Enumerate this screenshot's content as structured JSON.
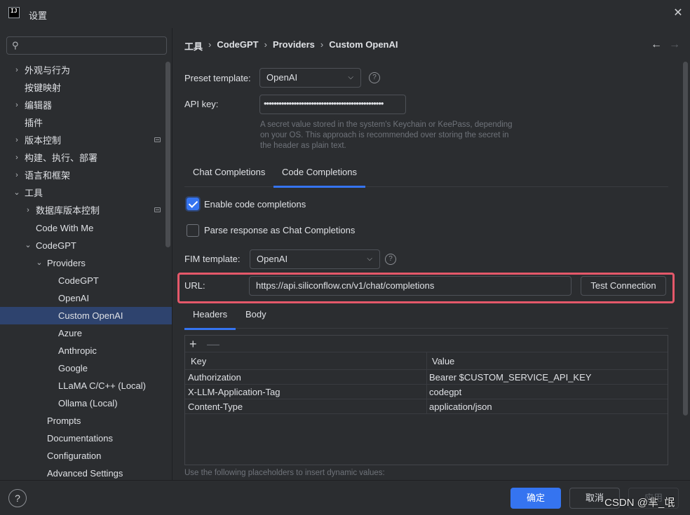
{
  "window": {
    "title": "设置",
    "logo_text": "IJ"
  },
  "search": {
    "placeholder": "",
    "icon": "search-icon"
  },
  "sidebar": {
    "items": [
      {
        "label": "外观与行为",
        "indent": 0,
        "chevron": "›",
        "badge": false
      },
      {
        "label": "按键映射",
        "indent": 0,
        "chevron": "",
        "badge": false
      },
      {
        "label": "编辑器",
        "indent": 0,
        "chevron": "›",
        "badge": false
      },
      {
        "label": "插件",
        "indent": 0,
        "chevron": "",
        "badge": false
      },
      {
        "label": "版本控制",
        "indent": 0,
        "chevron": "›",
        "badge": true
      },
      {
        "label": "构建、执行、部署",
        "indent": 0,
        "chevron": "›",
        "badge": false
      },
      {
        "label": "语言和框架",
        "indent": 0,
        "chevron": "›",
        "badge": false
      },
      {
        "label": "工具",
        "indent": 0,
        "chevron": "⌄",
        "badge": false
      },
      {
        "label": "数据库版本控制",
        "indent": 1,
        "chevron": "›",
        "badge": true
      },
      {
        "label": "Code With Me",
        "indent": 1,
        "chevron": "",
        "badge": false
      },
      {
        "label": "CodeGPT",
        "indent": 1,
        "chevron": "⌄",
        "badge": false
      },
      {
        "label": "Providers",
        "indent": 2,
        "chevron": "⌄",
        "badge": false
      },
      {
        "label": "CodeGPT",
        "indent": 3,
        "chevron": "",
        "badge": false
      },
      {
        "label": "OpenAI",
        "indent": 3,
        "chevron": "",
        "badge": false
      },
      {
        "label": "Custom OpenAI",
        "indent": 3,
        "chevron": "",
        "badge": false,
        "selected": true
      },
      {
        "label": "Azure",
        "indent": 3,
        "chevron": "",
        "badge": false
      },
      {
        "label": "Anthropic",
        "indent": 3,
        "chevron": "",
        "badge": false
      },
      {
        "label": "Google",
        "indent": 3,
        "chevron": "",
        "badge": false
      },
      {
        "label": "LLaMA C/C++ (Local)",
        "indent": 3,
        "chevron": "",
        "badge": false
      },
      {
        "label": "Ollama (Local)",
        "indent": 3,
        "chevron": "",
        "badge": false
      },
      {
        "label": "Prompts",
        "indent": 2,
        "chevron": "",
        "badge": false
      },
      {
        "label": "Documentations",
        "indent": 2,
        "chevron": "",
        "badge": false
      },
      {
        "label": "Configuration",
        "indent": 2,
        "chevron": "",
        "badge": false
      },
      {
        "label": "Advanced Settings",
        "indent": 2,
        "chevron": "",
        "badge": false
      }
    ]
  },
  "breadcrumb": [
    "工具",
    "CodeGPT",
    "Providers",
    "Custom OpenAI"
  ],
  "nav": {
    "back": "←",
    "forward": "→"
  },
  "form": {
    "preset_label": "Preset template:",
    "preset_value": "OpenAI",
    "api_key_label": "API key:",
    "api_key_value": "••••••••••••••••••••••••••••••••••••••••••••••••",
    "api_key_hint": "A secret value stored in the system's Keychain or KeePass, depending on your OS. This approach is recommended over storing the secret in the header as plain text.",
    "help_glyph": "?"
  },
  "tabs_main": {
    "items": [
      "Chat Completions",
      "Code Completions"
    ],
    "active": "Code Completions"
  },
  "code": {
    "enable_label": "Enable code completions",
    "enable_checked": true,
    "parse_label": "Parse response as Chat Completions",
    "parse_checked": false,
    "fim_label": "FIM template:",
    "fim_value": "OpenAI",
    "url_label": "URL:",
    "url_value": "https://api.siliconflow.cn/v1/chat/completions",
    "test_button": "Test Connection"
  },
  "tabs_sub": {
    "items": [
      "Headers",
      "Body"
    ],
    "active": "Headers"
  },
  "headers_table": {
    "add_glyph": "+",
    "remove_glyph": "—",
    "columns": [
      "Key",
      "Value"
    ],
    "rows": [
      [
        "Authorization",
        "Bearer $CUSTOM_SERVICE_API_KEY"
      ],
      [
        "X-LLM-Application-Tag",
        "codegpt"
      ],
      [
        "Content-Type",
        "application/json"
      ]
    ]
  },
  "placeholder_hint": "Use the following placeholders to insert dynamic values:",
  "footer": {
    "help": "?",
    "ok": "确定",
    "cancel": "取消",
    "apply": "应用"
  },
  "watermark": "CSDN @芈_氓",
  "colors": {
    "accent": "#3574f0",
    "selection": "#2e436e",
    "highlight_frame": "#e5586a",
    "background": "#2b2d30"
  }
}
